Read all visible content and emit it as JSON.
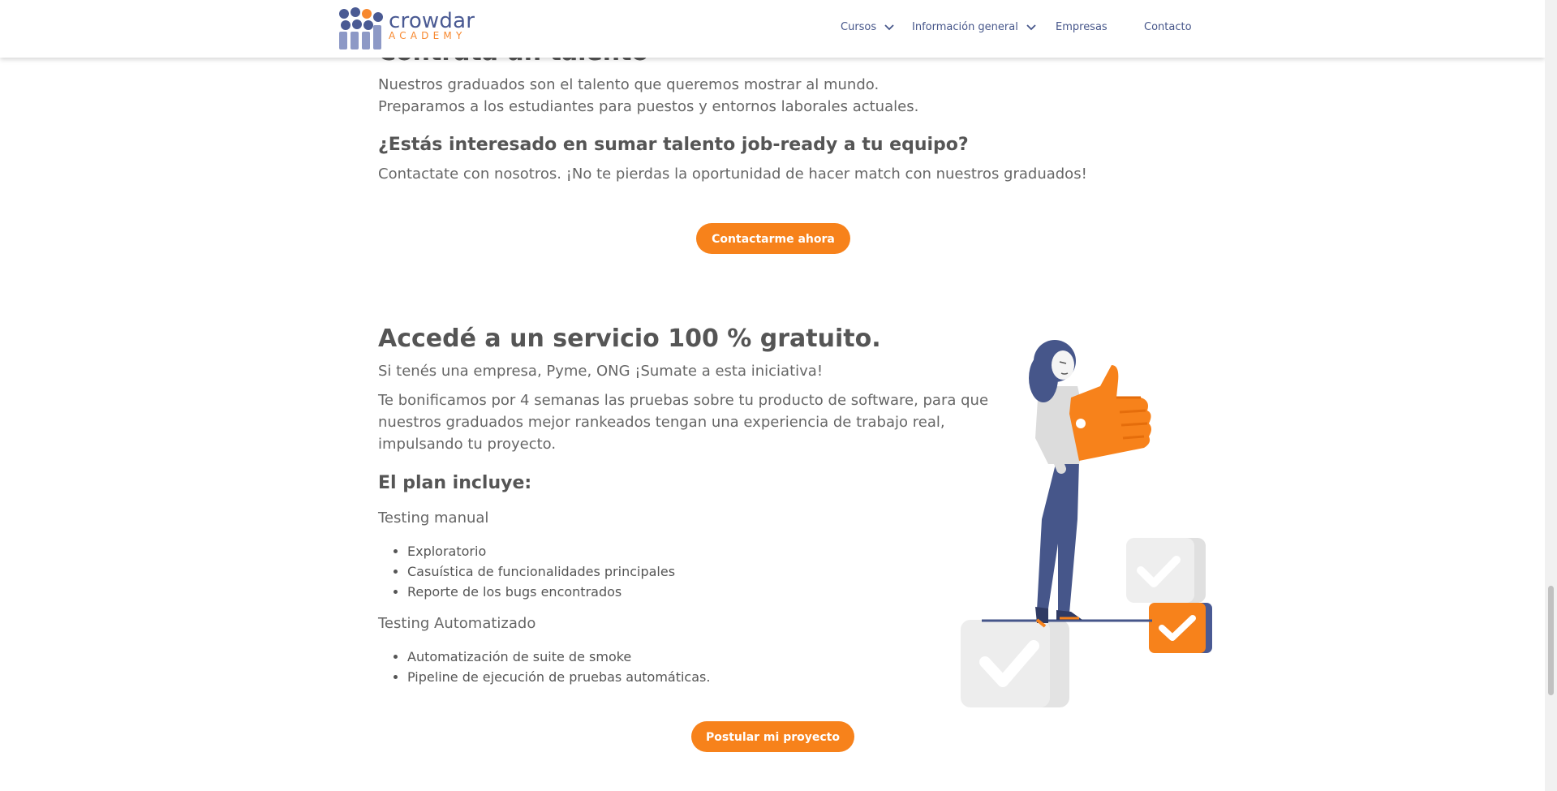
{
  "header": {
    "logo": {
      "name": "crowdar",
      "sub": "ACADEMY"
    },
    "nav": [
      {
        "label": "Cursos",
        "dropdown": true
      },
      {
        "label": "Información general",
        "dropdown": true
      },
      {
        "label": "Empresas",
        "dropdown": false
      },
      {
        "label": "Contacto",
        "dropdown": false
      }
    ]
  },
  "talent": {
    "heading_cut": "Contratá un talento",
    "line1": "Nuestros graduados son el talento que queremos mostrar al mundo.",
    "line2": "Preparamos a los estudiantes para puestos y entornos laborales actuales.",
    "question": "¿Estás interesado en sumar talento job-ready a tu equipo?",
    "cta_text": "Contactate con nosotros. ¡No te pierdas la oportunidad de hacer match con nuestros graduados!",
    "button": "Contactarme ahora"
  },
  "service": {
    "title": "Accedé a un servicio 100 % gratuito.",
    "subtitle": "Si tenés una empresa, Pyme, ONG ¡Sumate a esta iniciativa!",
    "description": "Te bonificamos por 4 semanas las pruebas sobre tu producto de software, para que nuestros graduados mejor rankeados tengan una experiencia de trabajo real, impulsando tu proyecto.",
    "plan_heading": "El plan incluye:",
    "manual_title": "Testing manual",
    "manual_items": [
      "Exploratorio",
      "Casuística de funcionalidades principales",
      "Reporte de los bugs encontrados"
    ],
    "auto_title": "Testing Automatizado",
    "auto_items": [
      "Automatización de suite de smoke",
      "Pipeline de ejecución de pruebas automáticas."
    ],
    "button": "Postular mi proyecto"
  },
  "colors": {
    "accent": "#f7821b",
    "brand": "#4a5a93",
    "text": "#666666"
  }
}
